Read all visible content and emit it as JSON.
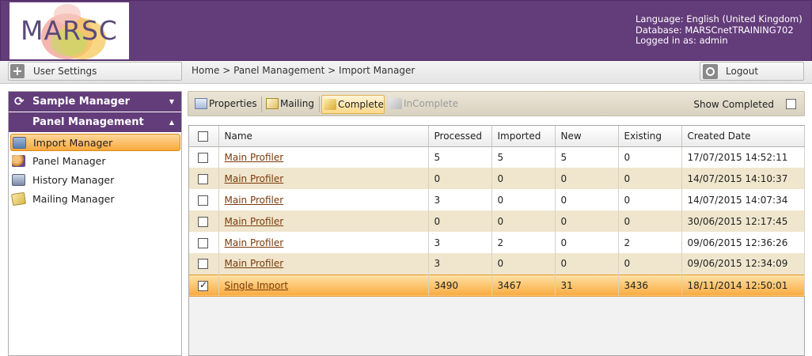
{
  "header": {
    "logo_text": "MARSC",
    "language": "Language: English (United Kingdom)",
    "database": "Database: MARSCnetTRAINING702",
    "logged_in": "Logged in as: admin"
  },
  "toolbar": {
    "user_settings": "User Settings",
    "breadcrumb": "Home > Panel Management > Import Manager",
    "logout": "Logout"
  },
  "sidebar": {
    "sample_manager": "Sample Manager",
    "panel_management": "Panel Management",
    "items": [
      {
        "label": "Import Manager",
        "icon": "import-icon"
      },
      {
        "label": "Panel Manager",
        "icon": "people-icon"
      },
      {
        "label": "History Manager",
        "icon": "history-icon"
      },
      {
        "label": "Mailing Manager",
        "icon": "mailing-icon"
      }
    ]
  },
  "actions": {
    "properties": "Properties",
    "mailing": "Mailing",
    "complete": "Complete",
    "incomplete": "InComplete",
    "show_completed": "Show Completed"
  },
  "table": {
    "headers": [
      "Name",
      "Processed",
      "Imported",
      "New",
      "Existing",
      "Created Date"
    ],
    "rows": [
      {
        "name": "Main Profiler",
        "processed": "5",
        "imported": "5",
        "new": "5",
        "existing": "0",
        "created": "17/07/2015 14:52:11",
        "checked": false
      },
      {
        "name": "Main Profiler",
        "processed": "0",
        "imported": "0",
        "new": "0",
        "existing": "0",
        "created": "14/07/2015 14:10:37",
        "checked": false
      },
      {
        "name": "Main Profiler",
        "processed": "3",
        "imported": "0",
        "new": "0",
        "existing": "0",
        "created": "14/07/2015 14:07:34",
        "checked": false
      },
      {
        "name": "Main Profiler",
        "processed": "0",
        "imported": "0",
        "new": "0",
        "existing": "0",
        "created": "30/06/2015 12:17:45",
        "checked": false
      },
      {
        "name": "Main Profiler",
        "processed": "3",
        "imported": "2",
        "new": "0",
        "existing": "2",
        "created": "09/06/2015 12:36:26",
        "checked": false
      },
      {
        "name": "Main Profiler",
        "processed": "3",
        "imported": "0",
        "new": "0",
        "existing": "0",
        "created": "09/06/2015 12:34:09",
        "checked": false
      },
      {
        "name": "Single Import",
        "processed": "3490",
        "imported": "3467",
        "new": "31",
        "existing": "3436",
        "created": "18/11/2014 12:50:01",
        "checked": true
      }
    ]
  },
  "colors": {
    "brand_purple": "#633c7a",
    "selected_orange": "#f9ab40",
    "alt_row": "#efe6cd"
  }
}
